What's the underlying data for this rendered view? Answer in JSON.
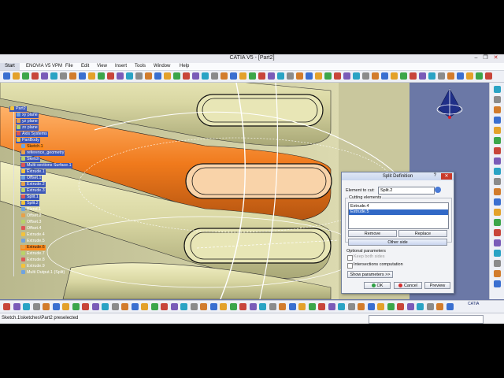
{
  "window": {
    "title": "CATIA V5 - [Part2]",
    "minimize": "–",
    "restore": "❐",
    "close": "✕"
  },
  "menu": {
    "start": "Start",
    "items": [
      "ENOVIA V5 VPM",
      "File",
      "Edit",
      "View",
      "Insert",
      "Tools",
      "Window",
      "Help"
    ]
  },
  "tree": {
    "nodes": [
      {
        "label": "Part2",
        "style": "sel"
      },
      {
        "label": "xy plane",
        "style": "sel"
      },
      {
        "label": "yz plane",
        "style": "sel"
      },
      {
        "label": "zx plane",
        "style": "sel"
      },
      {
        "label": "Axis Systems",
        "style": "sel"
      },
      {
        "label": "PartBody",
        "style": "sel"
      },
      {
        "label": "Sketch.1",
        "style": "hl"
      },
      {
        "label": "reference_geometry",
        "style": "sel"
      },
      {
        "label": "Sketch",
        "style": "sel"
      },
      {
        "label": "Multi-sections Surface.1",
        "style": "sel"
      },
      {
        "label": "Extrude.1",
        "style": "sel"
      },
      {
        "label": "Offset.1",
        "style": "sel"
      },
      {
        "label": "Extrude.2",
        "style": "sel"
      },
      {
        "label": "Extrude.3",
        "style": "sel"
      },
      {
        "label": "Split.1",
        "style": "sel"
      },
      {
        "label": "Split.2",
        "style": "sel"
      },
      {
        "label": "Blend.1",
        "style": "plain"
      },
      {
        "label": "Offset.2",
        "style": "plain"
      },
      {
        "label": "Offset.3",
        "style": "plain"
      },
      {
        "label": "Offset.4",
        "style": "plain"
      },
      {
        "label": "Extrude.4",
        "style": "plain"
      },
      {
        "label": "Extrude.5",
        "style": "plain"
      },
      {
        "label": "Extrude.6",
        "style": "hl"
      },
      {
        "label": "Extrude.7",
        "style": "plain"
      },
      {
        "label": "Extrude.8",
        "style": "plain"
      },
      {
        "label": "Extrude.9",
        "style": "plain"
      },
      {
        "label": "Multi Output.1 (Split)",
        "style": "plain"
      }
    ]
  },
  "dialog": {
    "title": "Split Definition",
    "help": "?",
    "close": "✕",
    "element_label": "Element to cut:",
    "element_value": "Split.2",
    "cutting_label": "Cutting elements",
    "cutting_items": [
      "Extrude.4",
      "Extrude.5"
    ],
    "remove": "Remove",
    "replace": "Replace",
    "other_side": "Other side",
    "optional_label": "Optional parameters",
    "keep_both": "Keep both sides",
    "intersections": "Intersections computation",
    "show_params": "Show parameters >>",
    "ok": "OK",
    "cancel": "Cancel",
    "preview": "Preview"
  },
  "status": {
    "message": "Sketch.1\\sketches\\Part2 preselected",
    "input": ""
  },
  "logo": "CATIA",
  "colors": {
    "accent_selection": "#3b57b8",
    "highlight_orange": "#ff8a1c",
    "background": "#6b78a6",
    "part_yellow": "#dcdca8"
  }
}
